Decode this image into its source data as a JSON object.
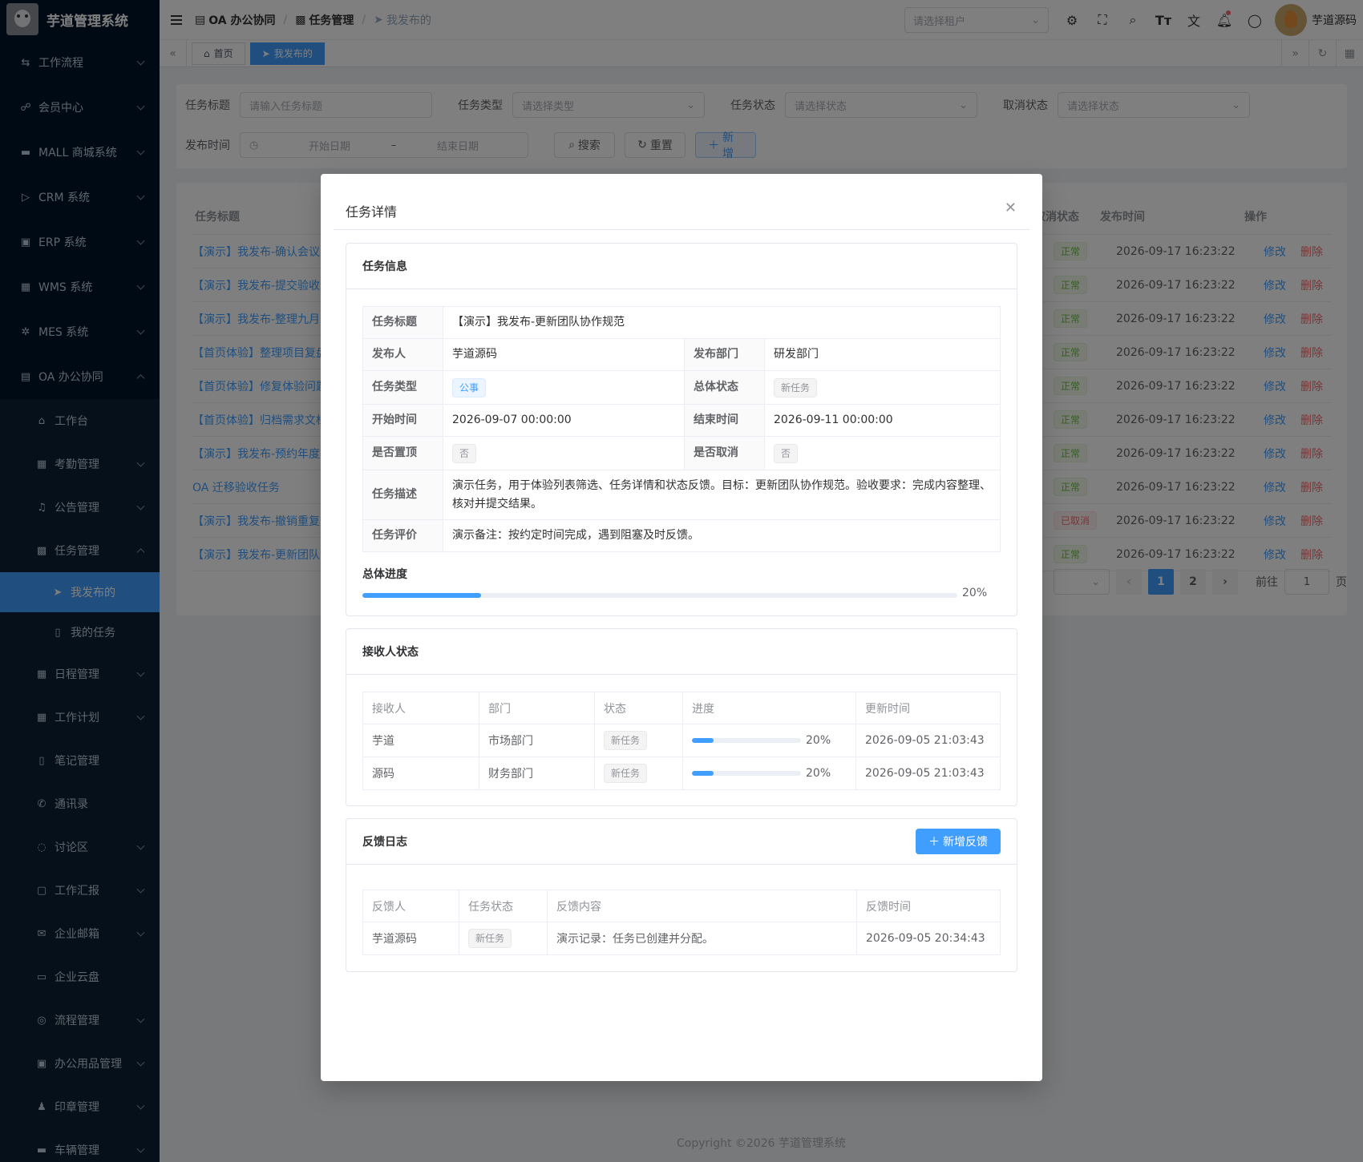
{
  "app": {
    "title": "芋道管理系统",
    "copyright": "Copyright ©2026 芋道管理系统"
  },
  "sidebar": {
    "items": [
      {
        "label": "工作流程",
        "icon": "workflow-icon"
      },
      {
        "label": "会员中心",
        "icon": "member-icon"
      },
      {
        "label": "MALL 商城系统",
        "icon": "mall-icon"
      },
      {
        "label": "CRM 系统",
        "icon": "crm-icon"
      },
      {
        "label": "ERP 系统",
        "icon": "erp-icon"
      },
      {
        "label": "WMS 系统",
        "icon": "wms-icon"
      },
      {
        "label": "MES 系统",
        "icon": "mes-icon"
      },
      {
        "label": "OA 办公协同",
        "icon": "oa-icon"
      }
    ],
    "oa_children": [
      {
        "label": "工作台"
      },
      {
        "label": "考勤管理"
      },
      {
        "label": "公告管理"
      },
      {
        "label": "任务管理"
      }
    ],
    "task_children": [
      {
        "label": "我发布的"
      },
      {
        "label": "我的任务"
      }
    ],
    "oa_children_after": [
      {
        "label": "日程管理"
      },
      {
        "label": "工作计划"
      },
      {
        "label": "笔记管理"
      },
      {
        "label": "通讯录"
      },
      {
        "label": "讨论区"
      },
      {
        "label": "工作汇报"
      },
      {
        "label": "企业邮箱"
      },
      {
        "label": "企业云盘"
      },
      {
        "label": "流程管理"
      },
      {
        "label": "办公用品管理"
      },
      {
        "label": "印章管理"
      },
      {
        "label": "车辆管理"
      }
    ]
  },
  "header": {
    "breadcrumb": [
      "OA 办公协同",
      "任务管理",
      "我发布的"
    ],
    "tenant_placeholder": "请选择租户",
    "user_name": "芋道源码"
  },
  "tags": {
    "home": "首页",
    "current": "我发布的"
  },
  "search": {
    "title_label": "任务标题",
    "title_placeholder": "请输入任务标题",
    "type_label": "任务类型",
    "type_placeholder": "请选择类型",
    "status_label": "任务状态",
    "status_placeholder": "请选择状态",
    "cancel_label": "取消状态",
    "cancel_placeholder": "请选择状态",
    "time_label": "发布时间",
    "start_placeholder": "开始日期",
    "range_sep": "–",
    "end_placeholder": "结束日期",
    "search_btn": "搜索",
    "reset_btn": "重置",
    "add_btn": "新增"
  },
  "table": {
    "headers": {
      "title": "任务标题",
      "cancel_status": "取消状态",
      "publish_time": "发布时间",
      "actions": "操作"
    },
    "rows": [
      {
        "title": "【演示】我发布-确认会议",
        "status": "正常",
        "time": "2026-09-17 16:23:22"
      },
      {
        "title": "【演示】我发布-提交验收",
        "status": "正常",
        "time": "2026-09-17 16:23:22"
      },
      {
        "title": "【演示】我发布-整理九月",
        "status": "正常",
        "time": "2026-09-17 16:23:22"
      },
      {
        "title": "【首页体验】整理项目复盘",
        "status": "正常",
        "time": "2026-09-17 16:23:22"
      },
      {
        "title": "【首页体验】修复体验问题",
        "status": "正常",
        "time": "2026-09-17 16:23:22"
      },
      {
        "title": "【首页体验】归档需求文档",
        "status": "正常",
        "time": "2026-09-17 16:23:22"
      },
      {
        "title": "【演示】我发布-预约年度",
        "status": "正常",
        "time": "2026-09-17 16:23:22"
      },
      {
        "title": "OA 迁移验收任务",
        "status": "正常",
        "time": "2026-09-17 16:23:22"
      },
      {
        "title": "【演示】我发布-撤销重复",
        "status": "已取消",
        "time": "2026-09-17 16:23:22"
      },
      {
        "title": "【演示】我发布-更新团队",
        "status": "正常",
        "time": "2026-09-17 16:23:22"
      }
    ],
    "edit": "修改",
    "delete": "删除",
    "pager": {
      "pages": [
        "1",
        "2"
      ],
      "goto": "前往",
      "page_value": "1",
      "page_unit": "页"
    }
  },
  "dialog": {
    "title": "任务详情",
    "info": {
      "heading": "任务信息",
      "title_label": "任务标题",
      "title_value": "【演示】我发布-更新团队协作规范",
      "publisher_label": "发布人",
      "publisher_value": "芋道源码",
      "dept_label": "发布部门",
      "dept_value": "研发部门",
      "type_label": "任务类型",
      "type_value": "公事",
      "overall_label": "总体状态",
      "overall_value": "新任务",
      "start_label": "开始时间",
      "start_value": "2026-09-07 00:00:00",
      "end_label": "结束时间",
      "end_value": "2026-09-11 00:00:00",
      "top_label": "是否置顶",
      "top_value": "否",
      "cancel_label": "是否取消",
      "cancel_value": "否",
      "desc_label": "任务描述",
      "desc_value": "演示任务，用于体验列表筛选、任务详情和状态反馈。目标：更新团队协作规范。验收要求：完成内容整理、核对并提交结果。",
      "eval_label": "任务评价",
      "eval_value": "演示备注：按约定时间完成，遇到阻塞及时反馈。",
      "progress_label": "总体进度",
      "progress": 20,
      "progress_text": "20%"
    },
    "receivers": {
      "heading": "接收人状态",
      "headers": [
        "接收人",
        "部门",
        "状态",
        "进度",
        "更新时间"
      ],
      "rows": [
        {
          "name": "芋道",
          "dept": "市场部门",
          "status": "新任务",
          "progress": 20,
          "progress_text": "20%",
          "time": "2026-09-05 21:03:43"
        },
        {
          "name": "源码",
          "dept": "财务部门",
          "status": "新任务",
          "progress": 20,
          "progress_text": "20%",
          "time": "2026-09-05 21:03:43"
        }
      ]
    },
    "feedback": {
      "heading": "反馈日志",
      "add_btn": "新增反馈",
      "headers": [
        "反馈人",
        "任务状态",
        "反馈内容",
        "反馈时间"
      ],
      "rows": [
        {
          "name": "芋道源码",
          "status": "新任务",
          "content": "演示记录：任务已创建并分配。",
          "time": "2026-09-05 20:34:43"
        }
      ]
    }
  },
  "colors": {
    "primary": "#409eff",
    "sidebar_bg": "#001529",
    "danger": "#f56c6c",
    "success": "#67c23a"
  }
}
